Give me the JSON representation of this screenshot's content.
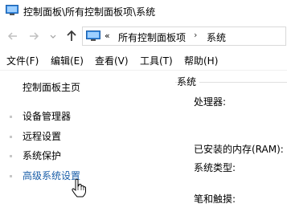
{
  "window": {
    "title": "控制面板\\所有控制面板项\\系统"
  },
  "nav": {
    "back_icon": "back-arrow-icon",
    "forward_icon": "forward-arrow-icon",
    "up_icon": "up-arrow-icon",
    "address": {
      "overflow_chevron": "«",
      "crumbs": [
        "所有控制面板项",
        "系统"
      ],
      "separator": "›"
    }
  },
  "menu": {
    "items": [
      {
        "label": "文件(F)"
      },
      {
        "label": "编辑(E)"
      },
      {
        "label": "查看(V)"
      },
      {
        "label": "工具(T)"
      },
      {
        "label": "帮助(H)"
      }
    ]
  },
  "sidebar": {
    "home": "控制面板主页",
    "items": [
      {
        "label": "设备管理器"
      },
      {
        "label": "远程设置"
      },
      {
        "label": "系统保护"
      },
      {
        "label": "高级系统设置"
      }
    ]
  },
  "content": {
    "section_title": "系统",
    "labels": [
      "处理器:",
      "已安装的内存(RAM):",
      "系统类型:",
      "笔和触摸:"
    ]
  },
  "colors": {
    "link": "#1a5ea8",
    "window_bg": "#ffffff"
  }
}
